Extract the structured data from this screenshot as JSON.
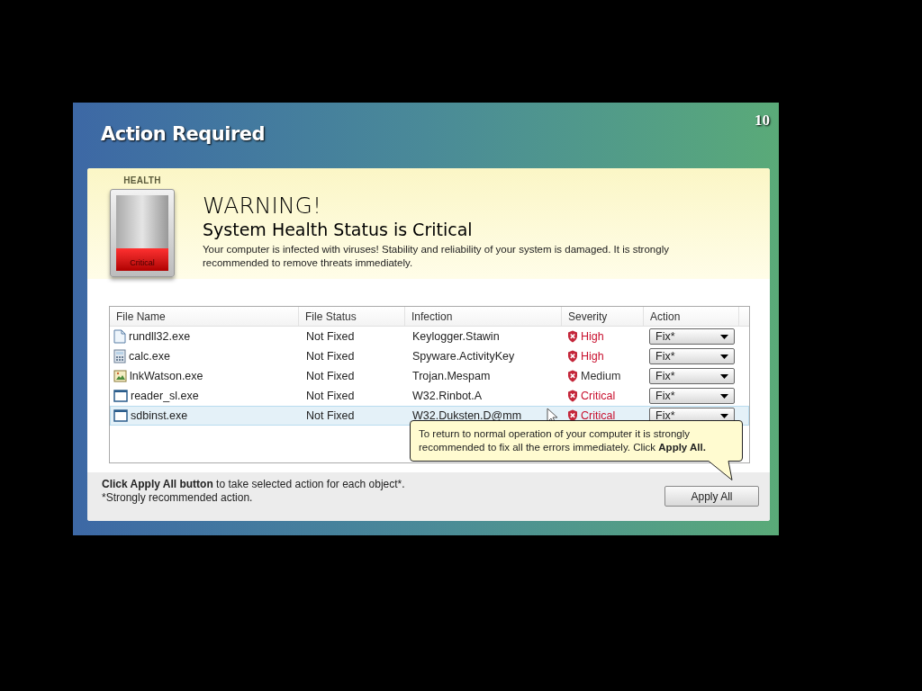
{
  "window": {
    "title": "Action Required",
    "countdown": "10"
  },
  "health": {
    "label": "HEALTH",
    "status": "Critical",
    "level": 0.3
  },
  "warning": {
    "heading": "WARNING!",
    "subheading": "System Health Status is Critical",
    "message": "Your computer is infected with viruses! Stability and reliability of your system is damaged. It is strongly recommended to remove threats immediately."
  },
  "table": {
    "columns": [
      "File Name",
      "File Status",
      "Infection",
      "Severity",
      "Action"
    ],
    "rows": [
      {
        "kind": "document",
        "file": "rundll32.exe",
        "status": "Not Fixed",
        "infection": "Keylogger.Stawin",
        "severity": "High",
        "color": "#c8102e",
        "action": "Fix*",
        "selected": false
      },
      {
        "kind": "calculator",
        "file": "calc.exe",
        "status": "Not Fixed",
        "infection": "Spyware.ActivityKey",
        "severity": "High",
        "color": "#c8102e",
        "action": "Fix*",
        "selected": false
      },
      {
        "kind": "image",
        "file": "lnkWatson.exe",
        "status": "Not Fixed",
        "infection": "Trojan.Mespam",
        "severity": "Medium",
        "color": "#333333",
        "action": "Fix*",
        "selected": false
      },
      {
        "kind": "window",
        "file": "reader_sl.exe",
        "status": "Not Fixed",
        "infection": "W32.Rinbot.A",
        "severity": "Critical",
        "color": "#c8102e",
        "action": "Fix*",
        "selected": false
      },
      {
        "kind": "window",
        "file": "sdbinst.exe",
        "status": "Not Fixed",
        "infection": "W32.Duksten.D@mm",
        "severity": "Critical",
        "color": "#c8102e",
        "action": "Fix*",
        "selected": true
      }
    ]
  },
  "tooltip": "To return to normal operation of your computer it is strongly recommended to fix all the errors immediately. Click **Apply All.**",
  "footer": {
    "note": "**Click Apply All button** to take selected action for each object*.",
    "footnote": "*Strongly recommended action."
  },
  "buttons": [
    "Apply All"
  ]
}
